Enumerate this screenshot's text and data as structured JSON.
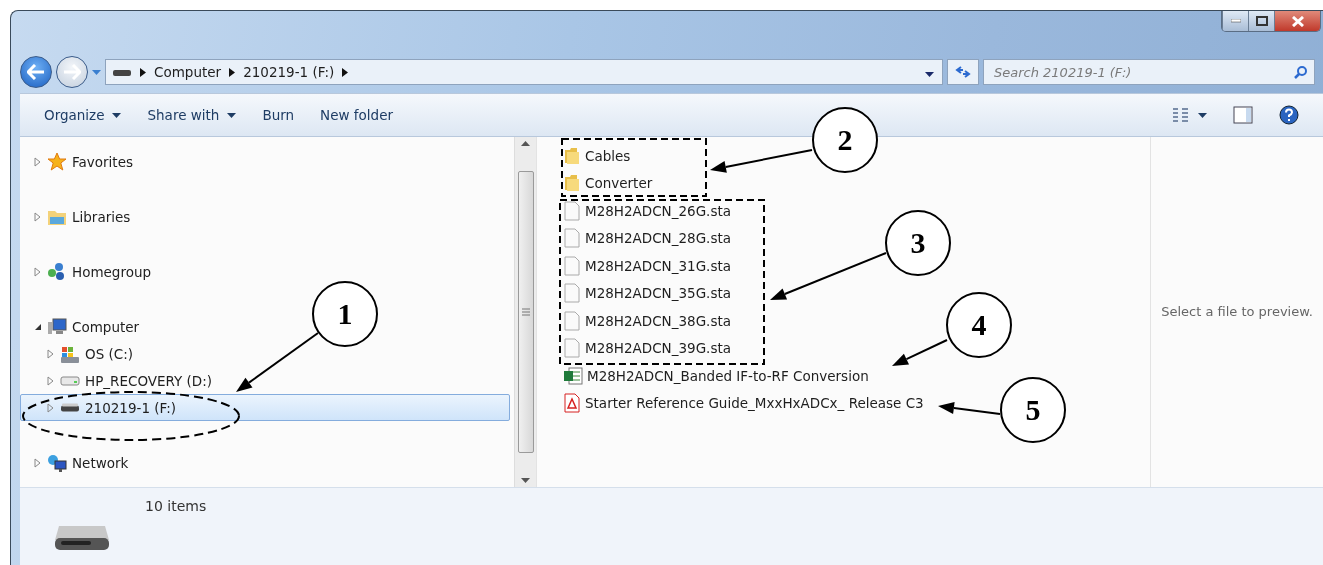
{
  "address": {
    "crumbs": [
      "Computer",
      "210219-1 (F:)"
    ]
  },
  "search": {
    "placeholder": "Search 210219-1 (F:)"
  },
  "toolbar": {
    "buttons": [
      {
        "label": "Organize",
        "dropdown": true
      },
      {
        "label": "Share with",
        "dropdown": true
      },
      {
        "label": "Burn",
        "dropdown": false
      },
      {
        "label": "New folder",
        "dropdown": false
      }
    ]
  },
  "navigation": {
    "items": [
      {
        "label": "Favorites",
        "kind": "star",
        "expanded": false,
        "selected": false
      },
      {
        "label": "Libraries",
        "kind": "libraries",
        "expanded": false,
        "selected": false
      },
      {
        "label": "Homegroup",
        "kind": "homegroup",
        "expanded": false,
        "selected": false
      },
      {
        "label": "Computer",
        "kind": "computer",
        "expanded": true,
        "selected": false,
        "children": [
          {
            "label": "OS (C:)",
            "kind": "system-drive",
            "expanded": false,
            "selected": false
          },
          {
            "label": "HP_RECOVERY (D:)",
            "kind": "drive",
            "expanded": false,
            "selected": false
          },
          {
            "label": "210219-1 (F:)",
            "kind": "usb-drive",
            "expanded": false,
            "selected": true
          }
        ]
      },
      {
        "label": "Network",
        "kind": "network",
        "expanded": false,
        "selected": false
      }
    ]
  },
  "files": [
    {
      "name": "Cables",
      "kind": "folder"
    },
    {
      "name": "Converter",
      "kind": "folder"
    },
    {
      "name": "M28H2ADCN_26G.sta",
      "kind": "file"
    },
    {
      "name": "M28H2ADCN_28G.sta",
      "kind": "file"
    },
    {
      "name": "M28H2ADCN_31G.sta",
      "kind": "file"
    },
    {
      "name": "M28H2ADCN_35G.sta",
      "kind": "file"
    },
    {
      "name": "M28H2ADCN_38G.sta",
      "kind": "file"
    },
    {
      "name": "M28H2ADCN_39G.sta",
      "kind": "file"
    },
    {
      "name": "M28H2ADCN_Banded IF-to-RF Conversion",
      "kind": "spreadsheet"
    },
    {
      "name": "Starter Reference Guide_MxxHxADCx_ Release C3",
      "kind": "pdf"
    }
  ],
  "preview": {
    "message": "Select a file to preview."
  },
  "status": {
    "count": "10 items"
  },
  "callouts": [
    {
      "number": "1"
    },
    {
      "number": "2"
    },
    {
      "number": "3"
    },
    {
      "number": "4"
    },
    {
      "number": "5"
    }
  ]
}
